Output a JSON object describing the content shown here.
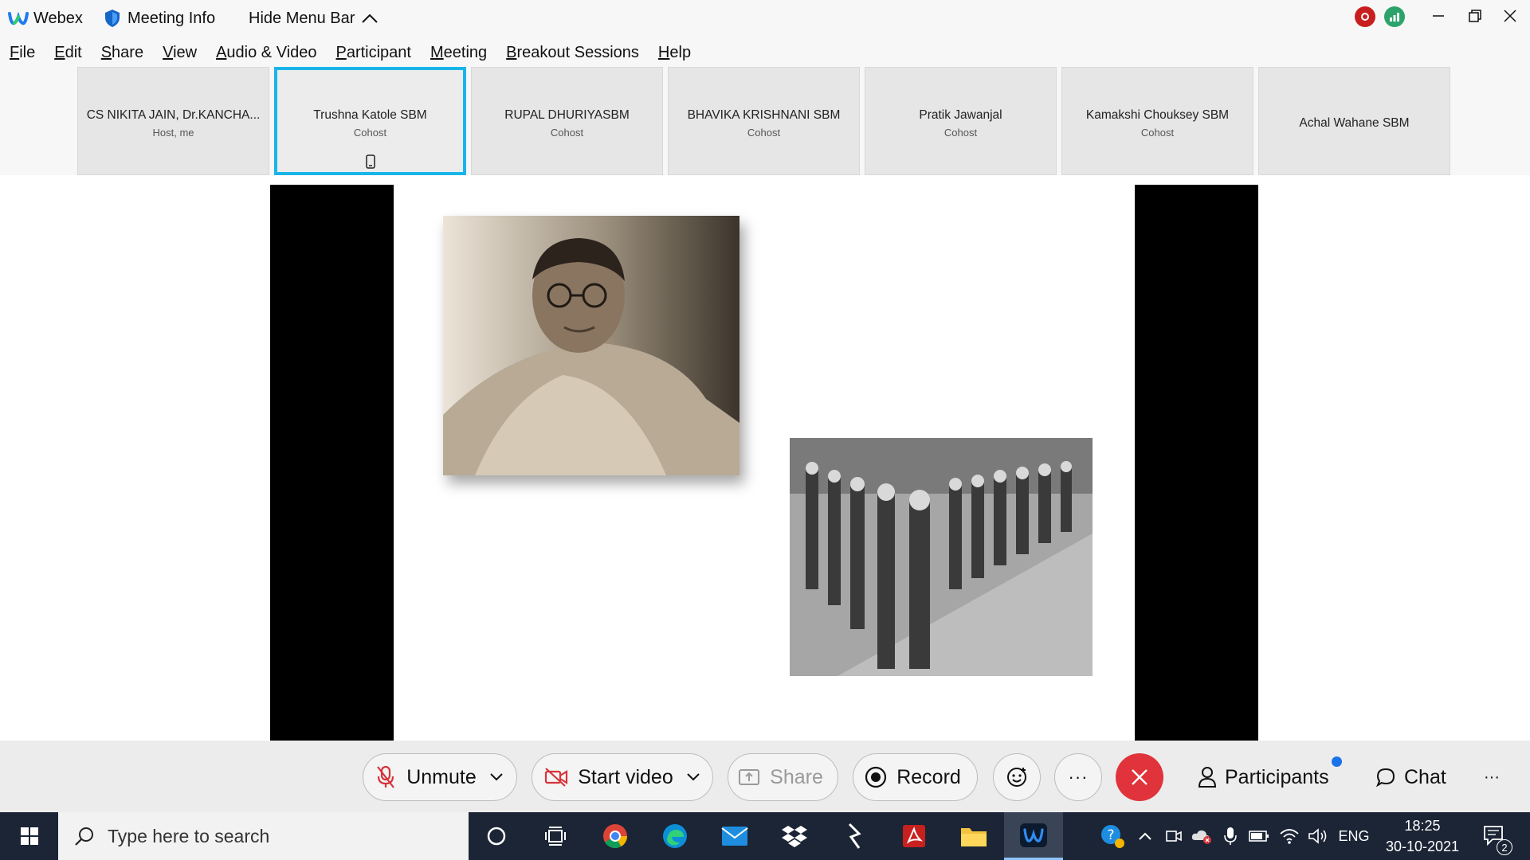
{
  "titlebar": {
    "app_name": "Webex",
    "meeting_info": "Meeting Info",
    "hide_menu_bar": "Hide Menu Bar"
  },
  "menubar": [
    {
      "u": "F",
      "rest": "ile"
    },
    {
      "u": "E",
      "rest": "dit"
    },
    {
      "u": "S",
      "rest": "hare"
    },
    {
      "u": "V",
      "rest": "iew"
    },
    {
      "u": "A",
      "rest": "udio & Video"
    },
    {
      "u": "P",
      "rest": "articipant"
    },
    {
      "u": "M",
      "rest": "eeting"
    },
    {
      "u": "B",
      "rest": "reakout Sessions"
    },
    {
      "u": "H",
      "rest": "elp"
    }
  ],
  "participants": [
    {
      "name": "CS NIKITA JAIN, Dr.KANCHA...",
      "role": "Host, me"
    },
    {
      "name": "Trushna Katole SBM",
      "role": "Cohost",
      "active": true
    },
    {
      "name": "RUPAL DHURIYASBM",
      "role": "Cohost"
    },
    {
      "name": "BHAVIKA KRISHNANI SBM",
      "role": "Cohost"
    },
    {
      "name": "Pratik Jawanjal",
      "role": "Cohost"
    },
    {
      "name": "Kamakshi Chouksey SBM",
      "role": "Cohost"
    },
    {
      "name": "Achal Wahane SBM",
      "role": ""
    }
  ],
  "controls": {
    "unmute": "Unmute",
    "start_video": "Start video",
    "share": "Share",
    "record": "Record",
    "participants": "Participants",
    "chat": "Chat",
    "more": "···"
  },
  "taskbar": {
    "search_placeholder": "Type here to search",
    "language": "ENG",
    "time": "18:25",
    "date": "30-10-2021",
    "notification_count": "2"
  },
  "colors": {
    "active_tile_border": "#1ab5e8",
    "end_call": "#e0333b",
    "taskbar": "#1b2535"
  }
}
